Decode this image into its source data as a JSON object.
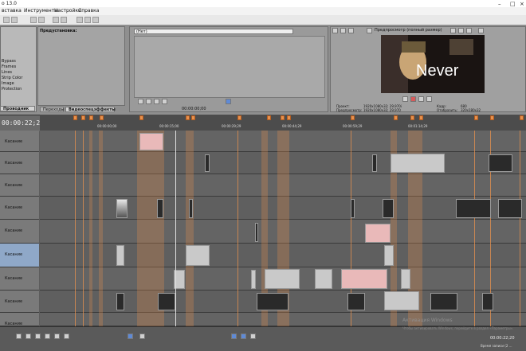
{
  "app": {
    "title": "o 13.0"
  },
  "menu": {
    "items": [
      "вставка",
      "Инструменты",
      "Настройки",
      "Справка"
    ]
  },
  "media_panel": {
    "heading": "Предустановка:",
    "list": [
      "Bypass",
      "Frames",
      "Lines",
      "Strip Color",
      "Image",
      "Protection"
    ],
    "tabs": [
      "Переходы",
      "Видеоспецэффекты"
    ],
    "bottom_tab": "Проводник"
  },
  "trimmer": {
    "dropdown": "(Нет)",
    "timecode": "00:00:00;00"
  },
  "preview": {
    "mode": "Предпросмотр (полный размер)",
    "overlay_text": "Never",
    "project_label": "Проект:",
    "project_value": "1920x1080x32; 29,970i",
    "preview_label": "Предпросмотр:",
    "preview_value": "1920x1080x32; 29,970",
    "frame_label": "Кадр:",
    "frame_value": "680",
    "display_label": "Отобразить:",
    "display_value": "320x180x32"
  },
  "timeline": {
    "timecode": "00:00:22;20",
    "ruler_labels": [
      "00:00:00;00",
      "00:00:15;00",
      "00:00:29;29",
      "00:00:44;29",
      "00:00:59;29",
      "00:01:14;29"
    ],
    "track_label": "Касание",
    "track_numbers": [
      "",
      "",
      "",
      "",
      "",
      "",
      "",
      "",
      "",
      "",
      "",
      "",
      ""
    ]
  },
  "bottom": {
    "timecode": "00:00:22;20",
    "status": "Время записи (2 ...",
    "watermark": "Активация Windows",
    "watermark_sub": "Чтобы активировать Windows, перейдите в раздел «Параметры»."
  },
  "colors": {
    "marker": "#e8914d",
    "background": "#5c5c5c"
  }
}
